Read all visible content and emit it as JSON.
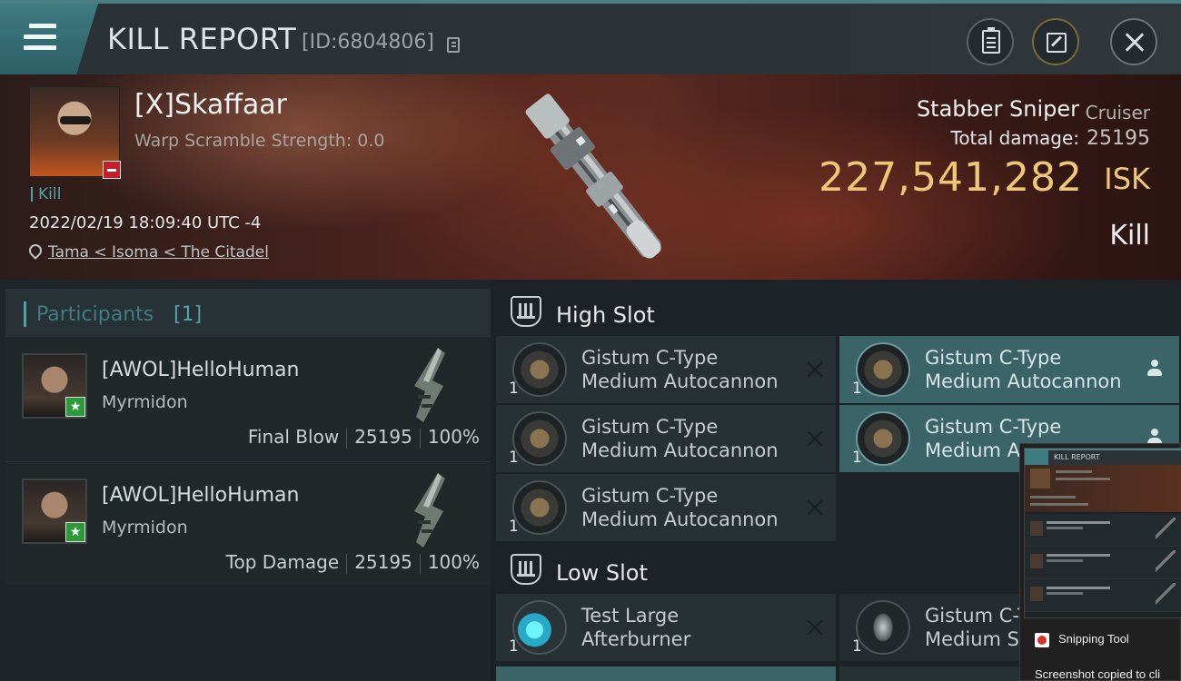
{
  "header": {
    "title": "KILL REPORT",
    "id_text": "[ID:6804806]"
  },
  "victim": {
    "name": "[X]Skaffaar",
    "warp_scramble": "Warp Scramble Strength: 0.0",
    "kill_tag": "Kill",
    "timestamp": "2022/02/19 18:09:40 UTC -4",
    "location": "Tama < Isoma < The Citadel"
  },
  "ship": {
    "name": "Stabber Sniper",
    "class": "Cruiser",
    "total_damage_label": "Total damage:",
    "total_damage_value": "25195",
    "isk_value": "227,541,282",
    "isk_label": "ISK",
    "kill_type": "Kill"
  },
  "participants": {
    "label": "Participants",
    "count": "[1]",
    "items": [
      {
        "name": "[AWOL]HelloHuman",
        "ship": "Myrmidon",
        "role": "Final Blow",
        "damage": "25195",
        "percent": "100%"
      },
      {
        "name": "[AWOL]HelloHuman",
        "ship": "Myrmidon",
        "role": "Top Damage",
        "damage": "25195",
        "percent": "100%"
      }
    ]
  },
  "slots": {
    "high": {
      "title": "High Slot",
      "modules": [
        {
          "qty": "1",
          "line1": "Gistum C-Type",
          "line2": "Medium Autocannon",
          "status": "destroyed"
        },
        {
          "qty": "1",
          "line1": "Gistum C-Type",
          "line2": "Medium Autocannon",
          "status": "dropped"
        },
        {
          "qty": "1",
          "line1": "Gistum C-Type",
          "line2": "Medium Autocannon",
          "status": "destroyed"
        },
        {
          "qty": "1",
          "line1": "Gistum C-Type",
          "line2": "Medium Au",
          "status": "dropped"
        },
        {
          "qty": "1",
          "line1": "Gistum C-Type",
          "line2": "Medium Autocannon",
          "status": "destroyed"
        }
      ]
    },
    "low": {
      "title": "Low Slot",
      "modules": [
        {
          "qty": "1",
          "line1": "Test Large",
          "line2": "Afterburner",
          "status": "destroyed"
        },
        {
          "qty": "1",
          "line1": "Gistum C-T",
          "line2": "Medium Sh",
          "status": "dropped"
        }
      ]
    }
  },
  "snipping_tool": {
    "thumb_title": "KILL REPORT",
    "app_name": "Snipping Tool",
    "message": "Screenshot copied to cli"
  },
  "colors": {
    "accent": "#4fa3a8",
    "isk": "#f0c778",
    "dropped_bg": "#3a6468",
    "destroyed_bg": "#273033"
  }
}
